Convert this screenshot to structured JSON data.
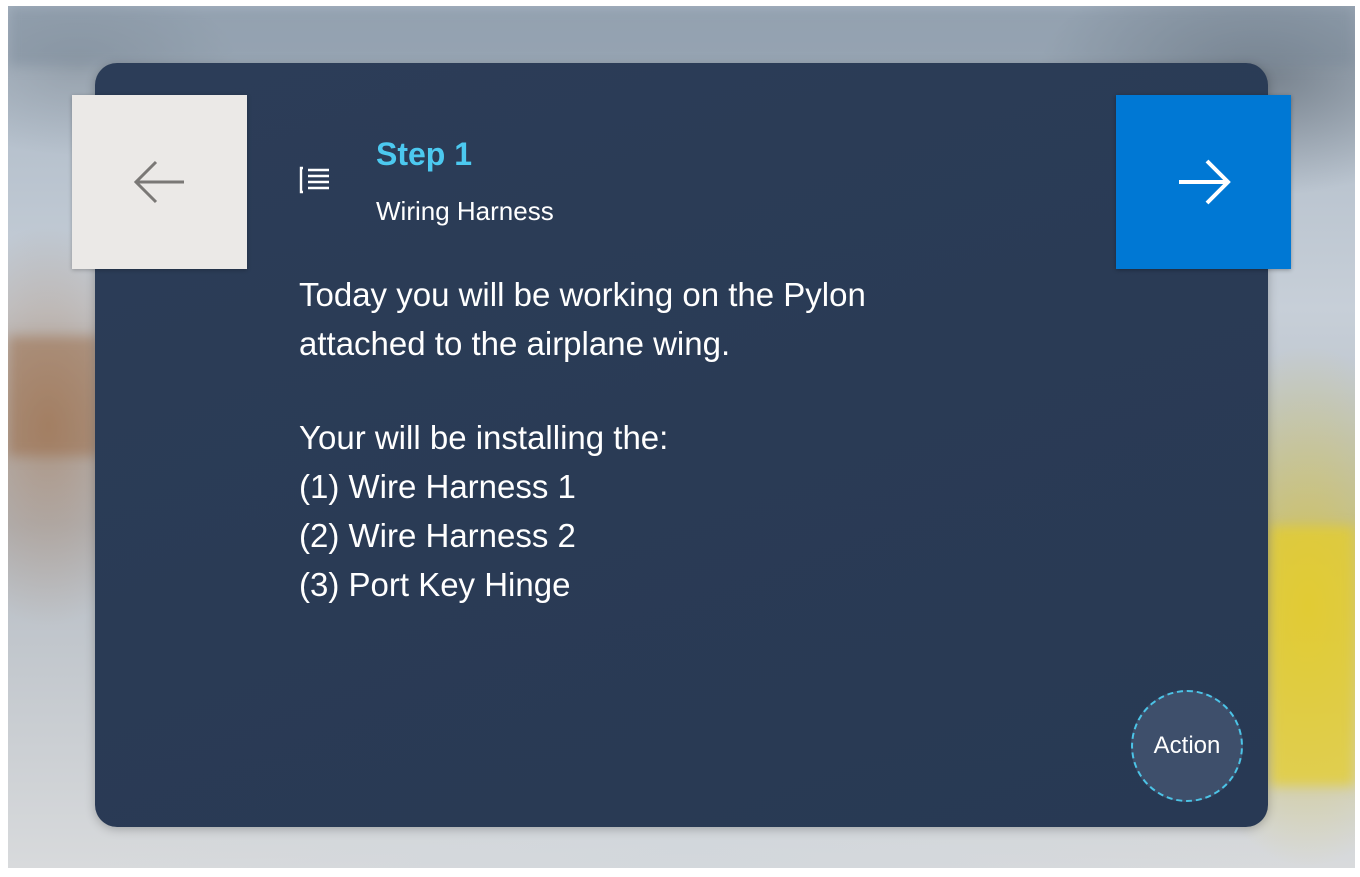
{
  "step": {
    "title": "Step 1",
    "subtitle": "Wiring Harness"
  },
  "content": {
    "intro_lines": [
      "Today you will be working on the Pylon",
      "attached to the airplane wing."
    ],
    "list_lines": [
      "Your will be installing the:",
      "(1) Wire Harness 1",
      "(2) Wire Harness 2",
      "(3) Port Key Hinge"
    ]
  },
  "buttons": {
    "back_icon": "arrow-left-icon",
    "next_icon": "arrow-right-icon",
    "action_label": "Action"
  },
  "icons": {
    "step_list": "list-icon"
  },
  "colors": {
    "card_background": "#2a3b55",
    "accent_title": "#4cc9f0",
    "next_button": "#0078d4",
    "back_button": "#ebe9e7",
    "action_border": "#4cc3e6"
  }
}
